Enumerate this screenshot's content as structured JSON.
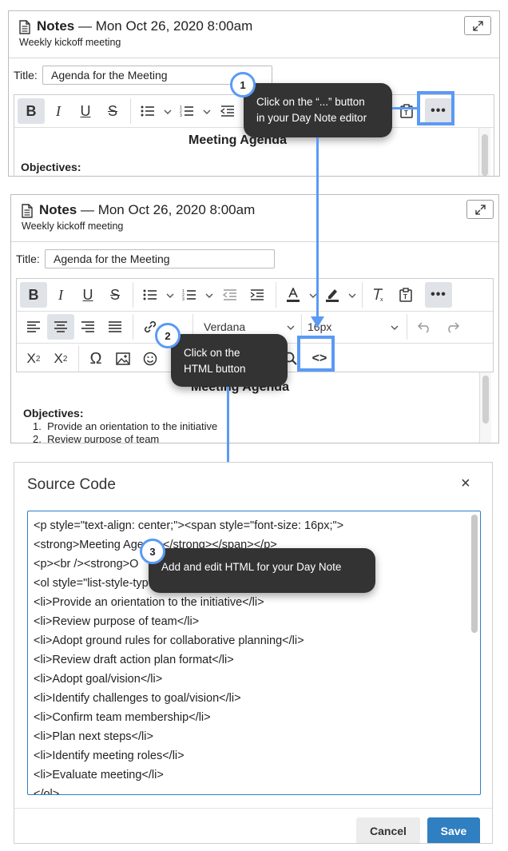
{
  "notes": {
    "heading": "Notes",
    "datetime": "— Mon Oct 26, 2020 8:00am",
    "subtitle": "Weekly kickoff meeting",
    "title_label": "Title:",
    "title_value": "Agenda for the Meeting",
    "editor_heading": "Meeting Agenda",
    "objectives_label": "Objectives:",
    "items": [
      "Provide an orientation to the initiative",
      "Review purpose of team"
    ],
    "font_family": "Verdana",
    "font_size": "16px"
  },
  "callouts": [
    {
      "number": "1",
      "text_line1": "Click on the “...” button",
      "text_line2": "in your Day Note editor"
    },
    {
      "number": "2",
      "text_line1": "Click on the",
      "text_line2": "HTML button"
    },
    {
      "number": "3",
      "text": "Add and edit HTML for your Day Note"
    }
  ],
  "source_code": {
    "title": "Source Code",
    "close_label": "×",
    "lines": [
      "<p style=\"text-align: center;\"><span style=\"font-size: 16px;\">",
      "<strong>Meeting Agenda</strong></span></p>",
      "<p><br /><strong>O",
      "<ol style=\"list-style-typ",
      "<li>Provide an orientation to the initiative</li>",
      "<li>Review purpose of team</li>",
      "<li>Adopt ground rules for collaborative planning</li>",
      "<li>Review draft action plan format</li>",
      "<li>Adopt goal/vision</li>",
      "<li>Identify challenges to goal/vision</li>",
      "<li>Confirm team membership</li>",
      "<li>Plan next steps</li>",
      "<li>Identify meeting roles</li>",
      "<li>Evaluate meeting</li>",
      "</ol>"
    ],
    "cancel_label": "Cancel",
    "save_label": "Save"
  },
  "colors": {
    "accent": "#5b9af5",
    "tooltip": "#333333",
    "save": "#2f7fc1"
  }
}
